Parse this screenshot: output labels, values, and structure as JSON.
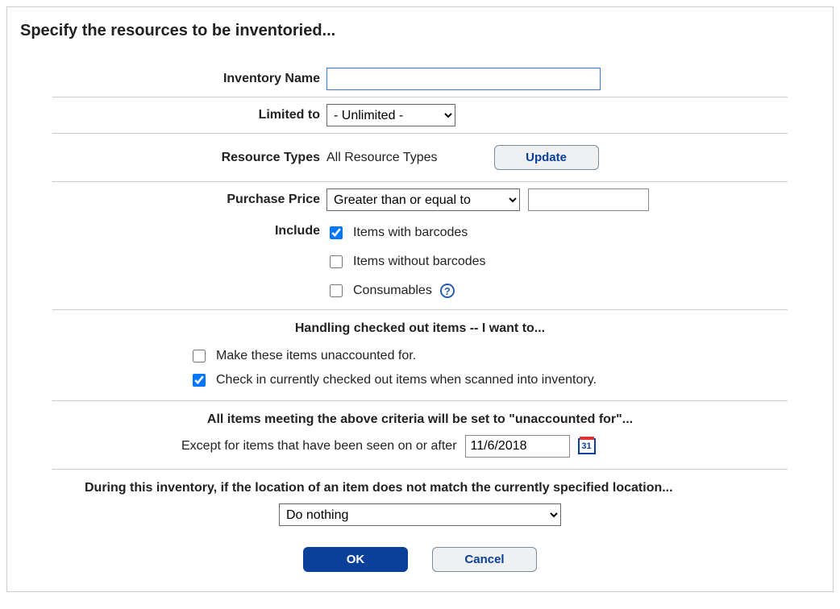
{
  "title": "Specify the resources to be inventoried...",
  "labels": {
    "inventory_name": "Inventory Name",
    "limited_to": "Limited to",
    "resource_types": "Resource Types",
    "purchase_price": "Purchase Price",
    "include": "Include"
  },
  "fields": {
    "inventory_name_value": "",
    "limited_to_selected": "- Unlimited -",
    "resource_types_text": "All Resource Types",
    "purchase_price_selected": "Greater than or equal to",
    "purchase_price_value": ""
  },
  "buttons": {
    "update": "Update",
    "ok": "OK",
    "cancel": "Cancel"
  },
  "include_options": {
    "with_barcodes": "Items with barcodes",
    "without_barcodes": "Items without barcodes",
    "consumables": "Consumables"
  },
  "handling": {
    "heading": "Handling checked out items -- I want to...",
    "unaccounted": "Make these items unaccounted for.",
    "checkin": "Check in currently checked out items when scanned into inventory."
  },
  "unaccounted_section": {
    "heading": "All items meeting the above criteria will be set to \"unaccounted for\"...",
    "except_label": "Except for items that have been seen on or after",
    "date_value": "11/6/2018"
  },
  "location_section": {
    "heading": "During this inventory, if the location of an item does not match the currently specified location...",
    "selected": "Do nothing"
  },
  "icons": {
    "calendar_day": "31"
  }
}
